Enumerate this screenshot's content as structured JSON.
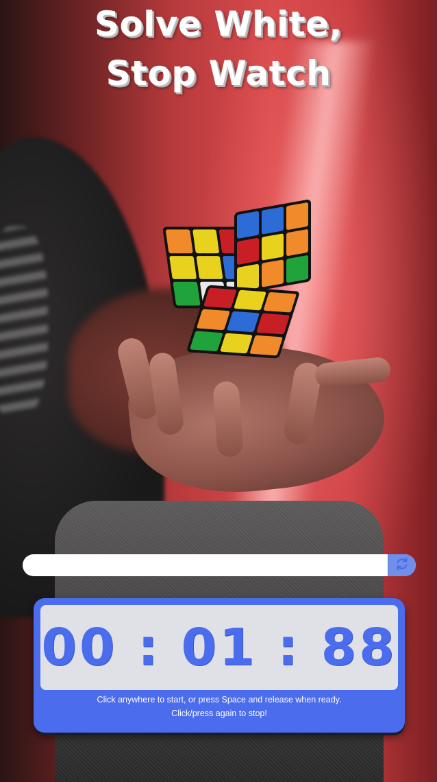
{
  "header": {
    "title_line1": "Solve White,",
    "title_line2": "Stop Watch"
  },
  "scramble": {
    "value": "",
    "placeholder": "",
    "refresh_icon": "refresh-icon"
  },
  "timer": {
    "display": "00 : 01  : 88",
    "instruction_line1": "Click anywhere to start, or press Space and release when ready.",
    "instruction_line2": "Click/press again to stop!"
  },
  "colors": {
    "accent": "#4a6ced",
    "timer_bg": "#e0e1e6",
    "refresh_button": "#6f8fe8"
  }
}
